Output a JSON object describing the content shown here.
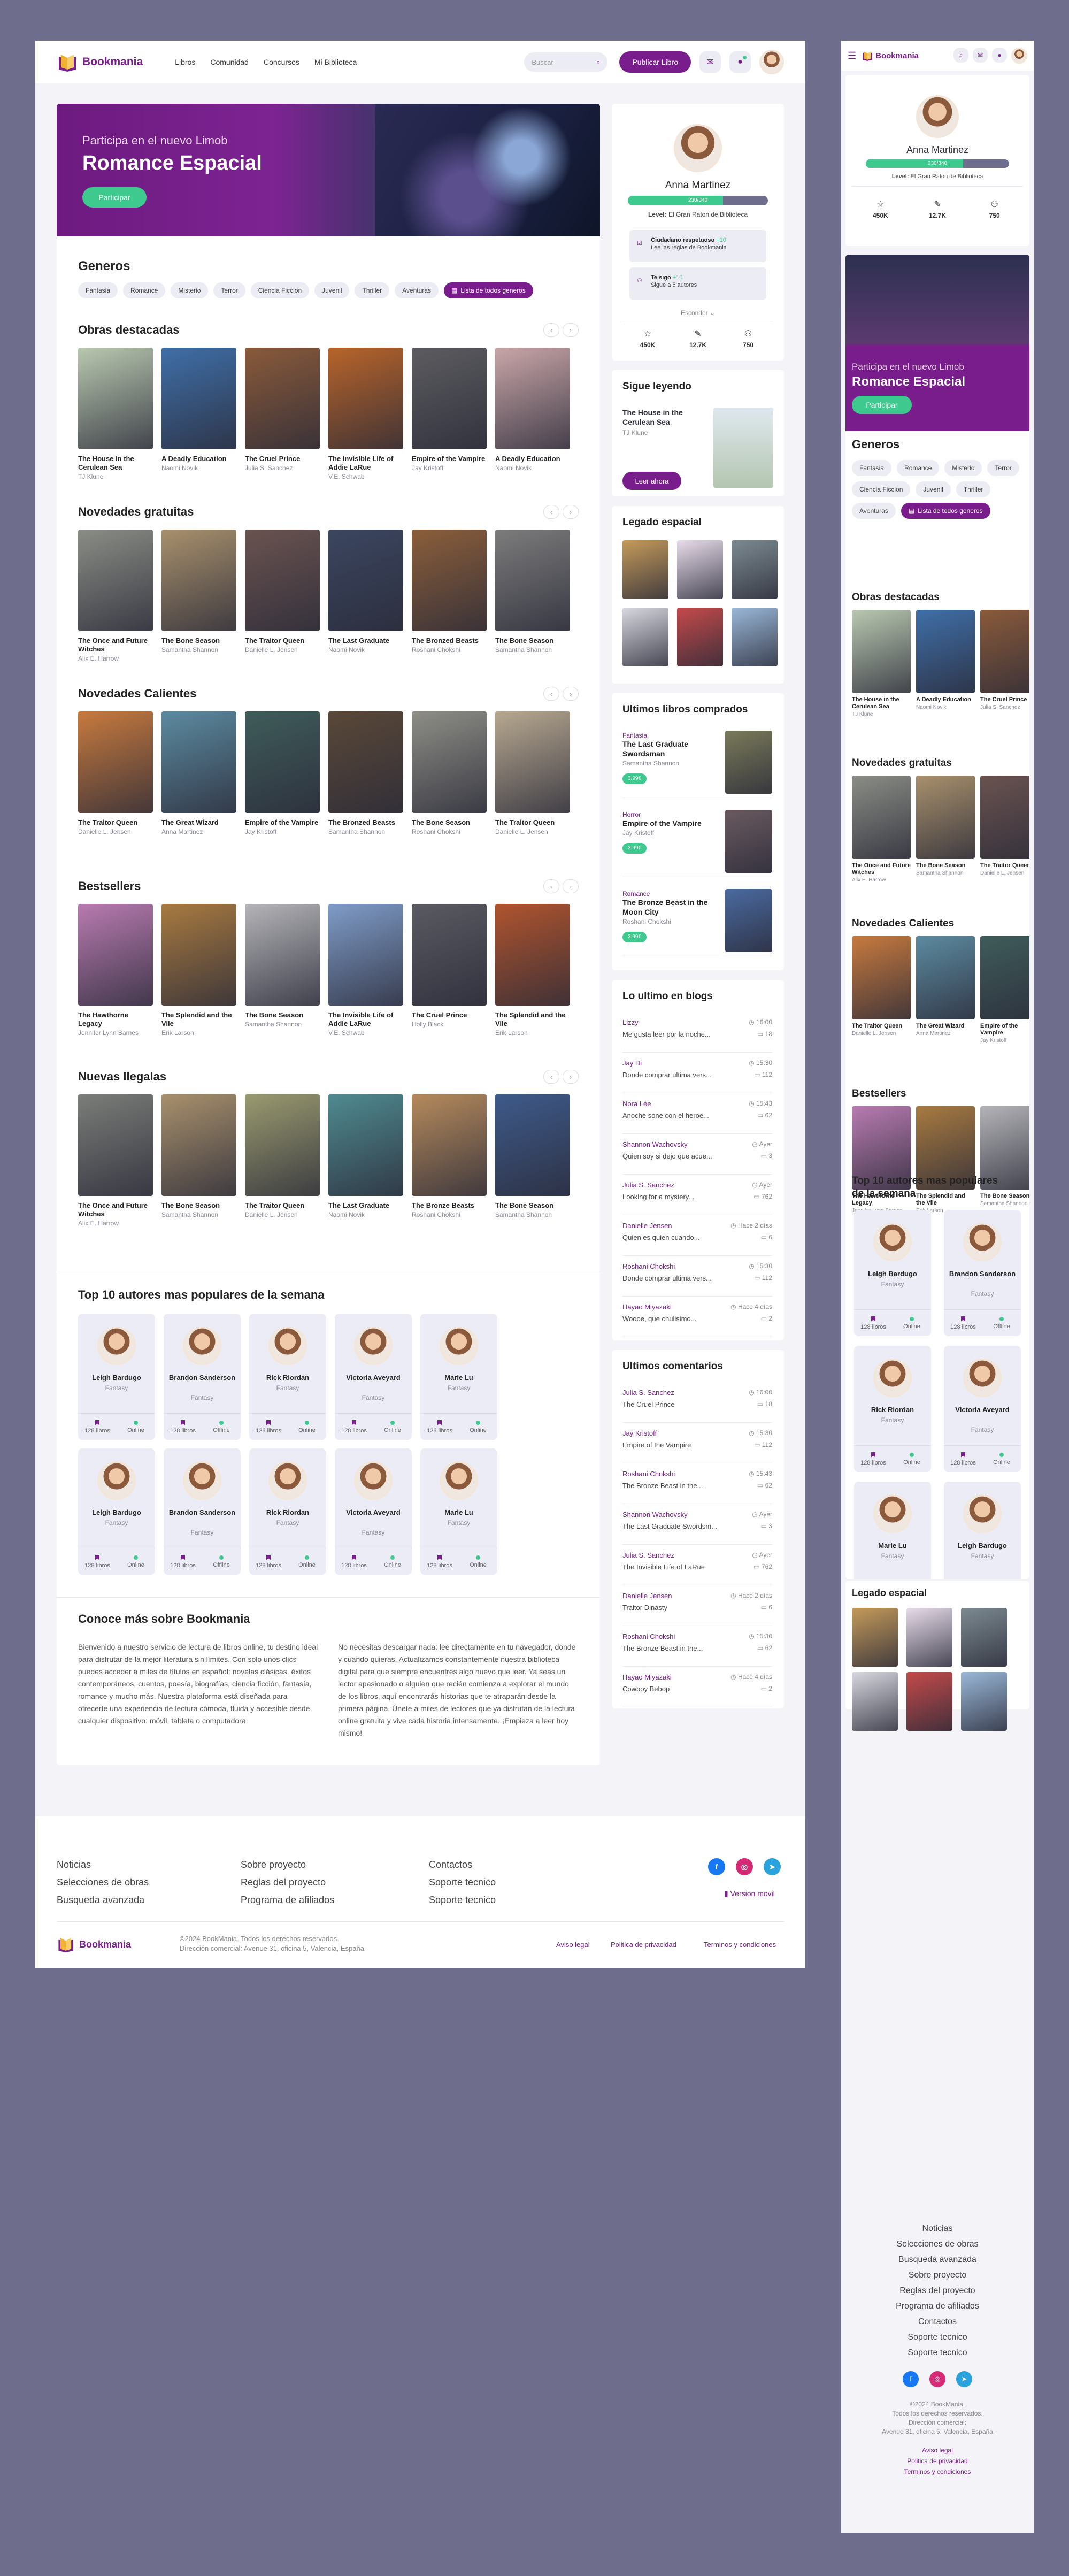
{
  "app": {
    "name": "Bookmania"
  },
  "nav": [
    "Libros",
    "Comunidad",
    "Concursos",
    "Mi Biblioteca"
  ],
  "search": {
    "placeholder": "Buscar"
  },
  "header": {
    "publish": "Publicar Libro"
  },
  "hero": {
    "sub": "Participa en el nuevo Limob",
    "title": "Romance Espacial",
    "cta": "Participar"
  },
  "genres": {
    "title": "Generos",
    "items": [
      "Fantasia",
      "Romance",
      "Misterio",
      "Terror",
      "Ciencia Ficcion",
      "Juvenil",
      "Thriller",
      "Aventuras"
    ],
    "all": "Lista de todos generos"
  },
  "sections": [
    {
      "title": "Obras destacadas",
      "books": [
        {
          "t": "The House in the Cerulean Sea",
          "a": "TJ Klune",
          "c": "#b9c8b0"
        },
        {
          "t": "A Deadly Education",
          "a": "Naomi Novik",
          "c": "#3f6fa8"
        },
        {
          "t": "The Cruel Prince",
          "a": "Julia S. Sanchez",
          "c": "#8a5a3a"
        },
        {
          "t": "The Invisible Life of Addie LaRue",
          "a": "V.E. Schwab",
          "c": "#b8642a"
        },
        {
          "t": "Empire of the Vampire",
          "a": "Jay Kristoff",
          "c": "#5c5c60"
        },
        {
          "t": "A Deadly Education",
          "a": "Naomi Novik",
          "c": "#c9a6a8"
        }
      ]
    },
    {
      "title": "Novedades gratuitas",
      "books": [
        {
          "t": "The Once and Future Witches",
          "a": "Alix E. Harrow",
          "c": "#8a8d85"
        },
        {
          "t": "The Bone Season",
          "a": "Samantha Shannon",
          "c": "#a8906c"
        },
        {
          "t": "The Traitor Queen",
          "a": "Danielle L. Jensen",
          "c": "#6a5350"
        },
        {
          "t": "The Last Graduate",
          "a": "Naomi Novik",
          "c": "#3b4660"
        },
        {
          "t": "The Bronzed Beasts",
          "a": "Roshani Chokshi",
          "c": "#8b5e3a"
        },
        {
          "t": "The Bone Season",
          "a": "Samantha Shannon",
          "c": "#7c7c7c"
        }
      ]
    },
    {
      "title": "Novedades Calientes",
      "books": [
        {
          "t": "The Traitor Queen",
          "a": "Danielle L. Jensen",
          "c": "#c77a3e"
        },
        {
          "t": "The Great Wizard",
          "a": "Anna Martinez",
          "c": "#5c8aa0"
        },
        {
          "t": "Empire of the Vampire",
          "a": "Jay Kristoff",
          "c": "#3f5c5a"
        },
        {
          "t": "The Bronzed Beasts",
          "a": "Samantha Shannon",
          "c": "#5a4838"
        },
        {
          "t": "The Bone Season",
          "a": "Roshani Chokshi",
          "c": "#8e8e86"
        },
        {
          "t": "The Traitor Queen",
          "a": "Danielle L. Jensen",
          "c": "#b7a890"
        }
      ]
    },
    {
      "title": "Bestsellers",
      "books": [
        {
          "t": "The Hawthorne Legacy",
          "a": "Jennifer Lynn Barnes",
          "c": "#b87bb0"
        },
        {
          "t": "The Splendid and the Vile",
          "a": "Erik Larson",
          "c": "#a87a40"
        },
        {
          "t": "The Bone Season",
          "a": "Samantha Shannon",
          "c": "#b4b4b8"
        },
        {
          "t": "The Invisible Life of Addie LaRue",
          "a": "V.E. Schwab",
          "c": "#7f9cc8"
        },
        {
          "t": "The Cruel Prince",
          "a": "Holly Black",
          "c": "#5a5a62"
        },
        {
          "t": "The Splendid and the Vile",
          "a": "Erik Larson",
          "c": "#b0542e"
        }
      ]
    },
    {
      "title": "Nuevas llegalas",
      "books": [
        {
          "t": "The Once and Future Witches",
          "a": "Alix E. Harrow",
          "c": "#7a7d78"
        },
        {
          "t": "The Bone Season",
          "a": "Samantha Shannon",
          "c": "#a8906c"
        },
        {
          "t": "The Traitor Queen",
          "a": "Danielle L. Jensen",
          "c": "#9a9a70"
        },
        {
          "t": "The Last Graduate",
          "a": "Naomi Novik",
          "c": "#4f8a90"
        },
        {
          "t": "The Bronze Beasts",
          "a": "Roshani Chokshi",
          "c": "#b58a5c"
        },
        {
          "t": "The Bone Season",
          "a": "Samantha Shannon",
          "c": "#3e5a8a"
        }
      ]
    }
  ],
  "authors": {
    "title": "Top 10 autores mas populares de la semana",
    "items": [
      {
        "n": "Leigh Bardugo",
        "g": "Fantasy",
        "b": "128 libros",
        "s": "Online"
      },
      {
        "n": "Brandon Sanderson",
        "g": "Fantasy",
        "b": "128 libros",
        "s": "Offline"
      },
      {
        "n": "Rick Riordan",
        "g": "Fantasy",
        "b": "128 libros",
        "s": "Online"
      },
      {
        "n": "Victoria Aveyard",
        "g": "Fantasy",
        "b": "128 libros",
        "s": "Online"
      },
      {
        "n": "Marie Lu",
        "g": "Fantasy",
        "b": "128 libros",
        "s": "Online"
      },
      {
        "n": "Leigh Bardugo",
        "g": "Fantasy",
        "b": "128 libros",
        "s": "Online"
      },
      {
        "n": "Brandon Sanderson",
        "g": "Fantasy",
        "b": "128 libros",
        "s": "Offline"
      },
      {
        "n": "Rick Riordan",
        "g": "Fantasy",
        "b": "128 libros",
        "s": "Online"
      },
      {
        "n": "Victoria Aveyard",
        "g": "Fantasy",
        "b": "128 libros",
        "s": "Online"
      },
      {
        "n": "Marie Lu",
        "g": "Fantasy",
        "b": "128 libros",
        "s": "Online"
      }
    ]
  },
  "about": {
    "title": "Conoce más sobre Bookmania",
    "p1": "Bienvenido a nuestro servicio de lectura de libros online, tu destino ideal para disfrutar de la mejor literatura sin límites. Con solo unos clics puedes acceder a miles de títulos en español: novelas clásicas, éxitos contemporáneos, cuentos, poesía, biografías, ciencia ficción, fantasía, romance y mucho más. Nuestra plataforma está diseñada para ofrecerte una experiencia de lectura cómoda, fluida y accesible desde cualquier dispositivo: móvil, tableta o computadora.",
    "p2": "No necesitas descargar nada: lee directamente en tu navegador, donde y cuando quieras. Actualizamos constantemente nuestra biblioteca digital para que siempre encuentres algo nuevo que leer. Ya seas un lector apasionado o alguien que recién comienza a explorar el mundo de los libros, aquí encontrarás historias que te atraparán desde la primera página. Únete a miles de lectores que ya disfrutan de la lectura online gratuita y vive cada historia intensamente. ¡Empieza a leer hoy mismo!"
  },
  "profile": {
    "name": "Anna Martinez",
    "xp": "230/340",
    "level_label": "Level:",
    "level": "El Gran Raton de Biblioteca",
    "level_pct": 0.68,
    "b1_title": "Ciudadano respetuoso",
    "b1_plus": "+10",
    "b1_sub": "Lee las reglas de Bookmania",
    "b2_title": "Te sigo",
    "b2_plus": "+10",
    "b2_sub": "Sigue a 5 autores",
    "more": "Esconder",
    "stats": [
      {
        "v": "450K",
        "i": "☆"
      },
      {
        "v": "12.7K",
        "i": "✎"
      },
      {
        "v": "750",
        "i": "⚇"
      }
    ]
  },
  "continue": {
    "title": "Sigue leyendo",
    "book": "The House in the Cerulean Sea",
    "author": "TJ Klune",
    "cta": "Leer ahora"
  },
  "legado": {
    "title": "Legado espacial",
    "colors": [
      "#c49a5a",
      "#e8dcea",
      "#7c8a90",
      "#d8d8e0",
      "#c44a4a",
      "#9ab8d8"
    ]
  },
  "purchases": {
    "title": "Ultimos libros comprados",
    "items": [
      {
        "c": "Fantasia",
        "t": "The Last Graduate Swordsman",
        "a": "Samantha Shannon",
        "p": "3.99€",
        "col": "#7a7a5a"
      },
      {
        "c": "Horror",
        "t": "Empire of the Vampire",
        "a": "Jay Kristoff",
        "p": "3.99€",
        "col": "#6a5a60"
      },
      {
        "c": "Romance",
        "t": "The Bronze Beast in the Moon City",
        "a": "Roshani Chokshi",
        "p": "3.99€",
        "col": "#4a6aa0"
      }
    ]
  },
  "blogs": {
    "title": "Lo ultimo en blogs",
    "items": [
      {
        "n": "Lizzy",
        "t": "Me gusta leer por la noche...",
        "d": "16:00",
        "c": "18"
      },
      {
        "n": "Jay Di",
        "t": "Donde comprar ultima vers...",
        "d": "15:30",
        "c": "112"
      },
      {
        "n": "Nora Lee",
        "t": "Anoche sone con el heroe...",
        "d": "15:43",
        "c": "62"
      },
      {
        "n": "Shannon Wachovsky",
        "t": "Quien soy si dejo que acue...",
        "d": "Ayer",
        "c": "3"
      },
      {
        "n": "Julia S. Sanchez",
        "t": "Looking for a mystery...",
        "d": "Ayer",
        "c": "762"
      },
      {
        "n": "Danielle Jensen",
        "t": "Quien es quien cuando...",
        "d": "Hace 2 días",
        "c": "6"
      },
      {
        "n": "Roshani Chokshi",
        "t": "Donde comprar ultima vers...",
        "d": "15:30",
        "c": "112"
      },
      {
        "n": "Hayao Miyazaki",
        "t": "Woooe, que chulisimo...",
        "d": "Hace 4 días",
        "c": "2"
      }
    ]
  },
  "comments": {
    "title": "Ultimos comentarios",
    "items": [
      {
        "n": "Julia S. Sanchez",
        "t": "The Cruel Prince",
        "d": "16:00",
        "c": "18"
      },
      {
        "n": "Jay Kristoff",
        "t": "Empire of the Vampire",
        "d": "15:30",
        "c": "112"
      },
      {
        "n": "Roshani Chokshi",
        "t": "The Bronze Beast in the...",
        "d": "15:43",
        "c": "62"
      },
      {
        "n": "Shannon Wachovsky",
        "t": "The Last Graduate Swordsm...",
        "d": "Ayer",
        "c": "3"
      },
      {
        "n": "Julia S. Sanchez",
        "t": "The Invisible Life of LaRue",
        "d": "Ayer",
        "c": "762"
      },
      {
        "n": "Danielle Jensen",
        "t": "Traitor Dinasty",
        "d": "Hace 2 días",
        "c": "6"
      },
      {
        "n": "Roshani Chokshi",
        "t": "The Bronze Beast in the...",
        "d": "15:30",
        "c": "62"
      },
      {
        "n": "Hayao Miyazaki",
        "t": "Cowboy Bebop",
        "d": "Hace 4 días",
        "c": "2"
      }
    ]
  },
  "footer": {
    "col1": [
      "Noticias",
      "Selecciones de obras",
      "Busqueda avanzada"
    ],
    "col2": [
      "Sobre proyecto",
      "Reglas del proyecto",
      "Programa de afiliados"
    ],
    "col3": [
      "Contactos",
      "Soporte tecnico",
      "Soporte tecnico"
    ],
    "mobile": "Version movil",
    "copy1": "©2024 BookMania. Todos los derechos reservados.",
    "copy2": "Dirección comercial: Avenue 31, oficina 5, Valencia, España",
    "legal": [
      "Aviso legal",
      "Politica de privacidad",
      "Terminos y condiciones"
    ],
    "social": [
      {
        "l": "f",
        "c": "#1877f2"
      },
      {
        "l": "◎",
        "c": "#d62976"
      },
      {
        "l": "➤",
        "c": "#2aa3dd"
      }
    ],
    "m_copy": [
      "©2024 BookMania.",
      "Todos los derechos reservados.",
      "Dirección comercial:",
      "Avenue 31, oficina 5, Valencia, España"
    ]
  },
  "colors": {
    "brand": "#7a1d8c",
    "accent": "#3ec98f"
  }
}
